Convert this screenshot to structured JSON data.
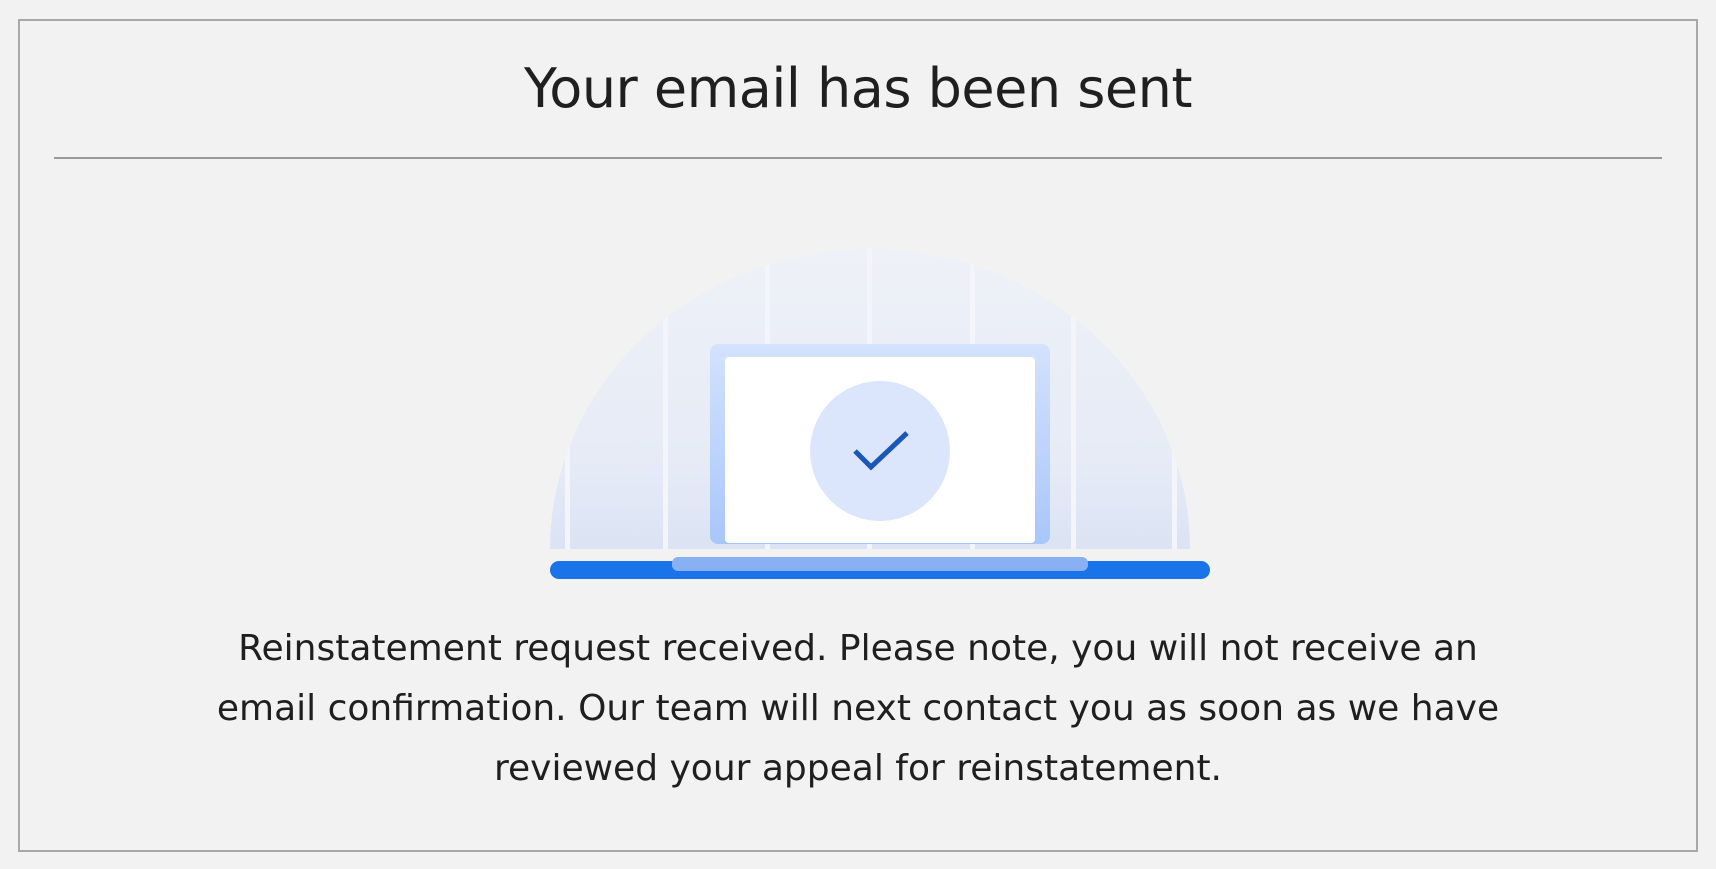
{
  "dialog": {
    "title": "Your email has been sent",
    "message": "Reinstatement request received. Please note, you will not receive an email confirmation. Our team will next contact you as soon as we have reviewed your appeal for reinstatement."
  },
  "illustration": {
    "icon": "laptop-checkmark-icon"
  },
  "colors": {
    "background": "#f2f2f2",
    "border": "#a8a8a8",
    "text": "#1f1f1f",
    "accent_blue": "#1a73e8",
    "check_blue": "#1b57b8",
    "light_blue": "#d9e6fc"
  }
}
